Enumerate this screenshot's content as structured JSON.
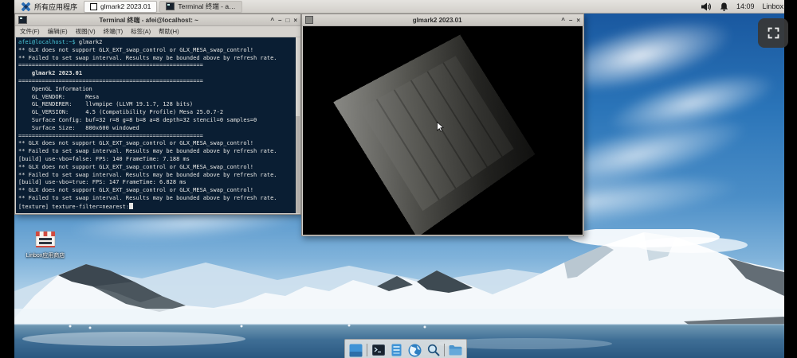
{
  "colors": {
    "accent_blue": "#2b6db5",
    "panel_bg": "#d9d6d2",
    "titlebar_bg": "#d4d1cc",
    "terminal_bg": "#0a1e33",
    "terminal_fg": "#e6e6e4",
    "prompt_color": "#49c7d8",
    "sky_top": "#17549c",
    "water_deep": "#2a5880",
    "fullscreen_btn_bg": "#3a3a3a"
  },
  "taskbar": {
    "menu_label": "所有应用程序",
    "windows": [
      {
        "label": "glmark2 2023.01"
      },
      {
        "label": "Terminal 终端 - a…"
      }
    ],
    "clock": "14:09",
    "user": "Linbox"
  },
  "terminal_window": {
    "title": "Terminal 终端 - afei@localhost: ~",
    "controls": [
      "^",
      "–",
      "□",
      "×"
    ],
    "menu": [
      "文件(F)",
      "编辑(E)",
      "视图(V)",
      "终端(T)",
      "标签(A)",
      "帮助(H)"
    ],
    "prompt": "afei@localhost:~$ ",
    "command": "glmark2",
    "lines": [
      "** GLX does not support GLX_EXT_swap_control or GLX_MESA_swap_control!",
      "** Failed to set swap interval. Results may be bounded above by refresh rate.",
      "=======================================================",
      "    glmark2 2023.01",
      "=======================================================",
      "    OpenGL Information",
      "    GL_VENDOR:      Mesa",
      "    GL_RENDERER:    llvmpipe (LLVM 19.1.7, 128 bits)",
      "    GL_VERSION:     4.5 (Compatibility Profile) Mesa 25.0.7-2",
      "    Surface Config: buf=32 r=8 g=8 b=8 a=8 depth=32 stencil=0 samples=0",
      "    Surface Size:   800x600 windowed",
      "=======================================================",
      "** GLX does not support GLX_EXT_swap_control or GLX_MESA_swap_control!",
      "** Failed to set swap interval. Results may be bounded above by refresh rate.",
      "[build] use-vbo=false: FPS: 140 FrameTime: 7.188 ms",
      "** GLX does not support GLX_EXT_swap_control or GLX_MESA_swap_control!",
      "** Failed to set swap interval. Results may be bounded above by refresh rate.",
      "[build] use-vbo=true: FPS: 147 FrameTime: 6.828 ms",
      "** GLX does not support GLX_EXT_swap_control or GLX_MESA_swap_control!",
      "** Failed to set swap interval. Results may be bounded above by refresh rate."
    ],
    "last_line": "[texture] texture-filter=nearest:"
  },
  "glmark_window": {
    "title": "glmark2 2023.01",
    "controls": [
      "^",
      "–",
      "×"
    ]
  },
  "desktop": {
    "store_icon_label": "Linbox应用商店"
  },
  "dock": {
    "items": [
      "show-desktop",
      "terminal",
      "software-center",
      "web-browser",
      "app-finder",
      "file-manager"
    ]
  }
}
